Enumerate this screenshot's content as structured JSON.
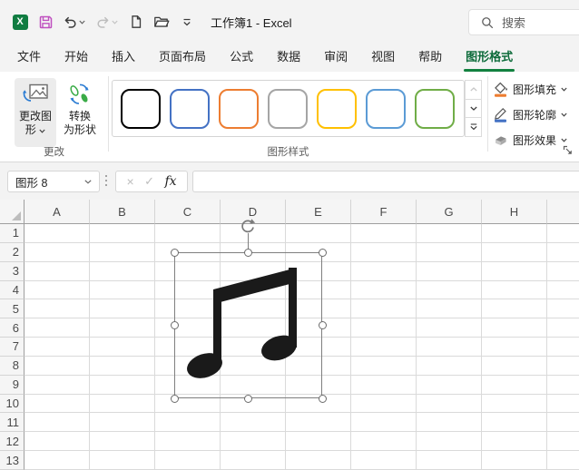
{
  "title_bar": {
    "title": "工作簿1 - Excel",
    "search_placeholder": "搜索"
  },
  "tabs": {
    "items": [
      {
        "id": "file",
        "label": "文件",
        "active": false
      },
      {
        "id": "home",
        "label": "开始",
        "active": false
      },
      {
        "id": "insert",
        "label": "插入",
        "active": false
      },
      {
        "id": "page-layout",
        "label": "页面布局",
        "active": false
      },
      {
        "id": "formulas",
        "label": "公式",
        "active": false
      },
      {
        "id": "data",
        "label": "数据",
        "active": false
      },
      {
        "id": "review",
        "label": "审阅",
        "active": false
      },
      {
        "id": "view",
        "label": "视图",
        "active": false
      },
      {
        "id": "help",
        "label": "帮助",
        "active": false
      },
      {
        "id": "graphics-format",
        "label": "图形格式",
        "active": true
      }
    ]
  },
  "ribbon": {
    "change_group": {
      "group_label": "更改",
      "change_graphic_line1": "更改图",
      "change_graphic_line2": "形",
      "convert_line1": "转换",
      "convert_line2": "为形状"
    },
    "styles_group": {
      "group_label": "图形样式",
      "swatches": [
        {
          "id": "style-1",
          "color": "#000000"
        },
        {
          "id": "style-2",
          "color": "#4472C4"
        },
        {
          "id": "style-3",
          "color": "#ED7D31"
        },
        {
          "id": "style-4",
          "color": "#A5A5A5"
        },
        {
          "id": "style-5",
          "color": "#FFC000"
        },
        {
          "id": "style-6",
          "color": "#5B9BD5"
        },
        {
          "id": "style-7",
          "color": "#70AD47"
        }
      ]
    },
    "format_group": {
      "fill_label": "图形填充",
      "outline_label": "图形轮廓",
      "effects_label": "图形效果",
      "fill_accent": "#ED7D31",
      "outline_accent": "#4472C4"
    }
  },
  "formula_bar": {
    "name_box_value": "图形 8",
    "fx_label": "fx",
    "formula_value": ""
  },
  "grid": {
    "columns": [
      "A",
      "B",
      "C",
      "D",
      "E",
      "F",
      "G",
      "H"
    ],
    "rows": [
      "1",
      "2",
      "3",
      "4",
      "5",
      "6",
      "7",
      "8",
      "9",
      "10",
      "11",
      "12",
      "13"
    ]
  },
  "canvas": {
    "shape_name": "music-note",
    "selection_color": "#7f7f7f"
  }
}
